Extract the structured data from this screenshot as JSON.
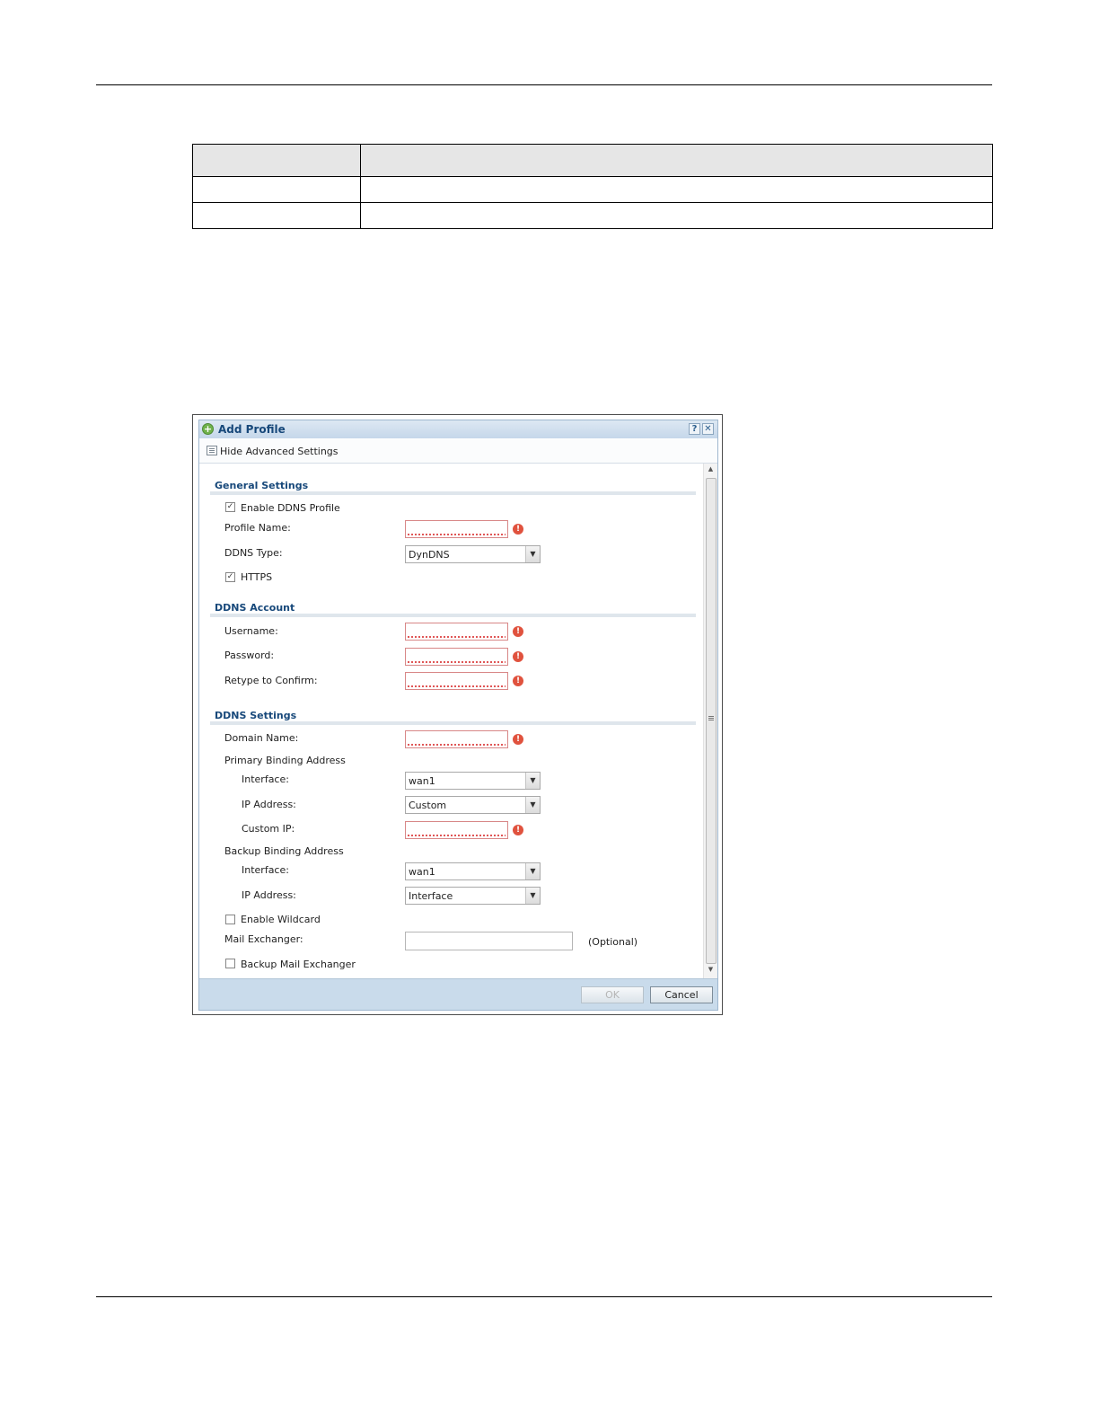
{
  "dialog": {
    "title": "Add Profile",
    "help_symbol": "?",
    "close_symbol": "✕",
    "advanced_toggle_label": "Hide Advanced Settings"
  },
  "general": {
    "heading": "General Settings",
    "enable_profile_label": "Enable DDNS Profile",
    "enable_profile_checked": true,
    "profile_name_label": "Profile Name:",
    "profile_name_value": "",
    "ddns_type_label": "DDNS Type:",
    "ddns_type_value": "DynDNS",
    "https_label": "HTTPS",
    "https_checked": true
  },
  "account": {
    "heading": "DDNS Account",
    "username_label": "Username:",
    "password_label": "Password:",
    "retype_label": "Retype to Confirm:"
  },
  "settings": {
    "heading": "DDNS Settings",
    "domain_name_label": "Domain Name:",
    "primary_heading": "Primary Binding Address",
    "primary_interface_label": "Interface:",
    "primary_interface_value": "wan1",
    "primary_ip_label": "IP Address:",
    "primary_ip_value": "Custom",
    "custom_ip_label": "Custom IP:",
    "backup_heading": "Backup Binding Address",
    "backup_interface_label": "Interface:",
    "backup_interface_value": "wan1",
    "backup_ip_label": "IP Address:",
    "backup_ip_value": "Interface",
    "enable_wildcard_label": "Enable Wildcard",
    "enable_wildcard_checked": false,
    "mail_exchanger_label": "Mail Exchanger:",
    "mail_exchanger_optional": "(Optional)",
    "backup_mail_label": "Backup Mail Exchanger",
    "backup_mail_checked": false
  },
  "footer": {
    "ok_label": "OK",
    "cancel_label": "Cancel"
  },
  "icons": {
    "check": "✓",
    "dropdown": "▼",
    "error": "!",
    "add": "+"
  },
  "colors": {
    "heading": "#17487a",
    "error": "#e0523e",
    "footer": "#c9dbeb"
  }
}
